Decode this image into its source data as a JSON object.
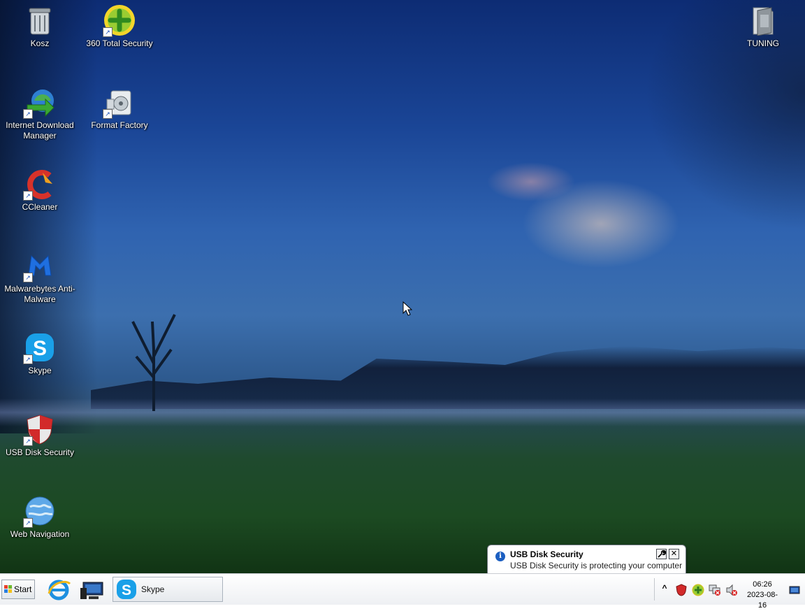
{
  "desktop": {
    "icons": [
      {
        "label": "Kosz",
        "icon": "recycle-bin-icon"
      },
      {
        "label": "360 Total Security",
        "icon": "360-total-security-icon"
      },
      {
        "label": "Internet Download Manager",
        "icon": "internet-download-manager-icon"
      },
      {
        "label": "Format Factory",
        "icon": "format-factory-icon"
      },
      {
        "label": "CCleaner",
        "icon": "ccleaner-icon"
      },
      {
        "label": "Malwarebytes Anti-Malware",
        "icon": "malwarebytes-icon"
      },
      {
        "label": "Skype",
        "icon": "skype-icon"
      },
      {
        "label": "USB Disk Security",
        "icon": "usb-disk-security-icon"
      },
      {
        "label": "Web Navigation",
        "icon": "web-navigation-icon"
      },
      {
        "label": "TUNING",
        "icon": "folder-icon"
      }
    ]
  },
  "taskbar": {
    "start_label": "Start",
    "skype_label": "Skype",
    "clock_time": "06:26",
    "clock_date": "2023-08-16",
    "tray_expand": "^"
  },
  "notification": {
    "title": "USB Disk Security",
    "message": "USB Disk Security is protecting your computer",
    "info_glyph": "i",
    "close_glyph": "✕"
  },
  "colors": {
    "taskbar_bg": "#eef0f3",
    "info_blue": "#1c5fc1"
  }
}
